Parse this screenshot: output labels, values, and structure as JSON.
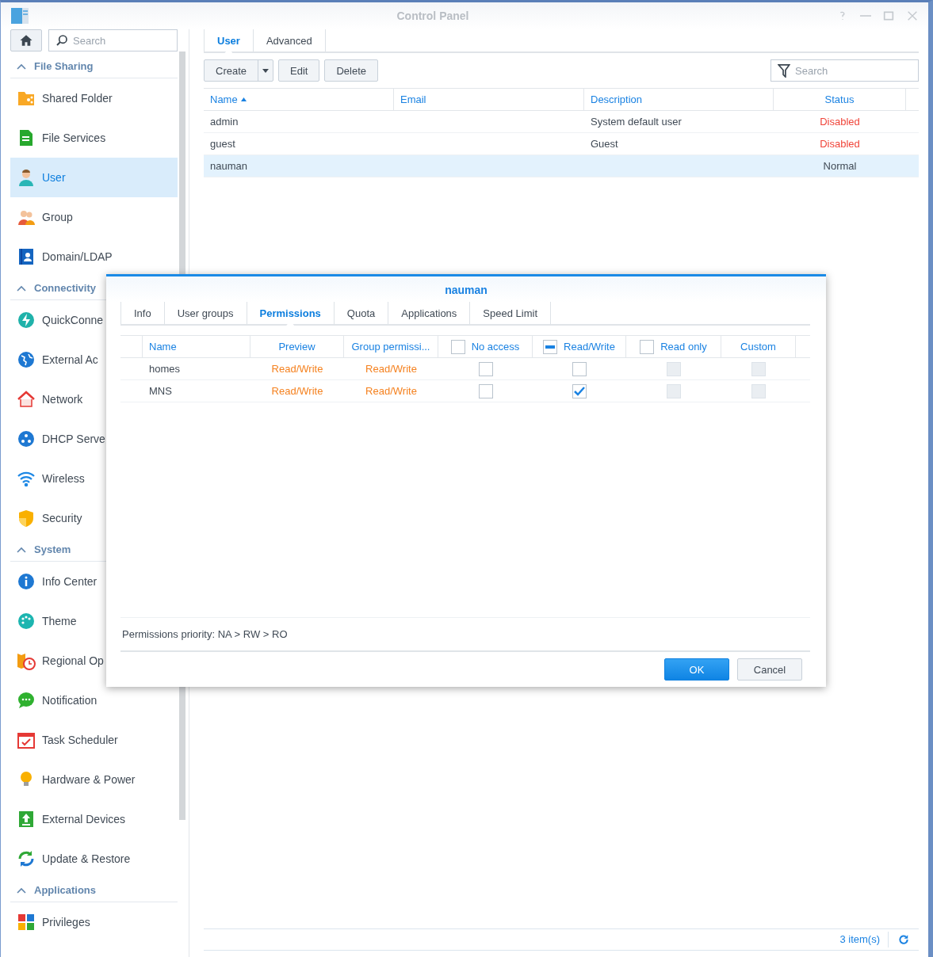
{
  "window": {
    "title": "Control Panel"
  },
  "sidebar": {
    "search": {
      "placeholder": "Search"
    },
    "sections": [
      {
        "title": "File Sharing",
        "expanded": true,
        "items": [
          {
            "label": "Shared Folder",
            "selected": false
          },
          {
            "label": "File Services",
            "selected": false
          },
          {
            "label": "User",
            "selected": true
          },
          {
            "label": "Group",
            "selected": false
          },
          {
            "label": "Domain/LDAP",
            "selected": false
          }
        ]
      },
      {
        "title": "Connectivity",
        "expanded": true,
        "items": [
          {
            "label": "QuickConne",
            "selected": false
          },
          {
            "label": "External Ac",
            "selected": false
          },
          {
            "label": "Network",
            "selected": false
          },
          {
            "label": "DHCP Serve",
            "selected": false
          },
          {
            "label": "Wireless",
            "selected": false
          },
          {
            "label": "Security",
            "selected": false
          }
        ]
      },
      {
        "title": "System",
        "expanded": true,
        "items": [
          {
            "label": "Info Center",
            "selected": false
          },
          {
            "label": "Theme",
            "selected": false
          },
          {
            "label": "Regional Op",
            "selected": false
          },
          {
            "label": "Notification",
            "selected": false
          },
          {
            "label": "Task Scheduler",
            "selected": false
          },
          {
            "label": "Hardware & Power",
            "selected": false
          },
          {
            "label": "External Devices",
            "selected": false
          },
          {
            "label": "Update & Restore",
            "selected": false
          }
        ]
      },
      {
        "title": "Applications",
        "expanded": true,
        "items": [
          {
            "label": "Privileges",
            "selected": false
          }
        ]
      }
    ]
  },
  "tabs": [
    {
      "label": "User",
      "selected": true
    },
    {
      "label": "Advanced",
      "selected": false
    }
  ],
  "toolbar": {
    "buttons": [
      {
        "label": "Create",
        "kind": "split"
      },
      {
        "label": "Edit",
        "kind": "plain"
      },
      {
        "label": "Delete",
        "kind": "plain"
      }
    ],
    "search": {
      "placeholder": "Search"
    }
  },
  "table": {
    "columns": [
      {
        "label": "Name",
        "sorted": true
      },
      {
        "label": "Email",
        "sorted": false
      },
      {
        "label": "Description",
        "sorted": false
      },
      {
        "label": "Status",
        "sorted": false
      }
    ],
    "rows": [
      {
        "name": "admin",
        "description": "System default user",
        "status": {
          "text": "Disabled",
          "color": "#f0453a"
        },
        "selected": false
      },
      {
        "name": "guest",
        "description": "Guest",
        "status": {
          "text": "Disabled",
          "color": "#f0453a"
        },
        "selected": false
      },
      {
        "name": "nauman",
        "status": {
          "text": "Normal",
          "color": "#404a55"
        },
        "selected": true
      }
    ]
  },
  "status_bar": {
    "count": "3 item(s)"
  },
  "dialog": {
    "title": "nauman",
    "tabs": [
      {
        "label": "Info",
        "selected": false
      },
      {
        "label": "User groups",
        "selected": false
      },
      {
        "label": "Permissions",
        "selected": true
      },
      {
        "label": "Quota",
        "selected": false
      },
      {
        "label": "Applications",
        "selected": false
      },
      {
        "label": "Speed Limit",
        "selected": false
      }
    ],
    "columns": [
      {
        "label": "Name",
        "kind": "text"
      },
      {
        "label": "Preview",
        "kind": "text"
      },
      {
        "label": "Group permissi...",
        "kind": "text"
      },
      {
        "label": "No access",
        "kind": "checkbox",
        "indeterminate": false
      },
      {
        "label": "Read/Write",
        "kind": "checkbox",
        "indeterminate": true
      },
      {
        "label": "Read only",
        "kind": "checkbox",
        "indeterminate": false
      },
      {
        "label": "Custom",
        "kind": "text"
      }
    ],
    "rows": [
      {
        "name": "homes",
        "preview": "Read/Write",
        "group_permission": "Read/Write",
        "no_access": {
          "checked": false,
          "disabled": false
        },
        "read_write": {
          "checked": false,
          "disabled": false
        },
        "read_only": {
          "checked": false,
          "disabled": true
        },
        "custom": {
          "checked": false,
          "disabled": true
        }
      },
      {
        "name": "MNS",
        "preview": "Read/Write",
        "group_permission": "Read/Write",
        "no_access": {
          "checked": false,
          "disabled": false
        },
        "read_write": {
          "checked": true,
          "disabled": false
        },
        "read_only": {
          "checked": false,
          "disabled": true
        },
        "custom": {
          "checked": false,
          "disabled": true
        }
      }
    ],
    "note": "Permissions priority: NA > RW > RO",
    "buttons": [
      {
        "label": "OK",
        "kind": "primary"
      },
      {
        "label": "Cancel",
        "kind": "secondary"
      }
    ]
  }
}
